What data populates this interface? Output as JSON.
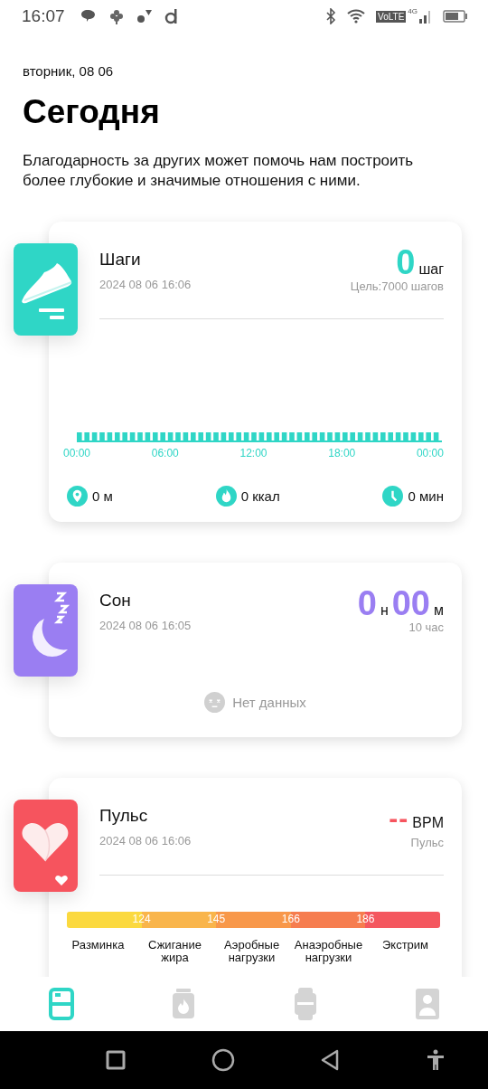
{
  "status_bar": {
    "time": "16:07",
    "network_type": "VoLTE",
    "network_generation": "4G"
  },
  "date": "вторник, 08 06",
  "title": "Сегодня",
  "quote": "Благодарность за других может помочь нам построить более глубокие и значимые отношения с ними.",
  "steps_card": {
    "title": "Шаги",
    "timestamp": "2024 08 06 16:06",
    "value": "0",
    "unit": "шаг",
    "goal": "Цель:7000 шагов",
    "axis_labels": [
      "00:00",
      "06:00",
      "12:00",
      "18:00",
      "00:00"
    ],
    "stats": [
      {
        "kind": "distance",
        "text": "0 м"
      },
      {
        "kind": "calories",
        "text": "0 ккал"
      },
      {
        "kind": "duration",
        "text": "0 мин"
      }
    ]
  },
  "sleep_card": {
    "title": "Сон",
    "timestamp": "2024 08 06 16:05",
    "hours": "0",
    "hours_unit": "н",
    "minutes": "00",
    "minutes_unit": "м",
    "goal": "10 час",
    "empty_message": "Нет данных"
  },
  "pulse_card": {
    "title": "Пульс",
    "timestamp": "2024 08 06 16:06",
    "value": "--",
    "unit": "BPM",
    "subtitle": "Пульс",
    "thresholds": [
      "124",
      "145",
      "166",
      "186"
    ],
    "zones": [
      {
        "label": "Разминка",
        "color": "#fbd93f"
      },
      {
        "label": "Сжигание жира",
        "color": "#f9b54b"
      },
      {
        "label": "Аэробные нагрузки",
        "color": "#f8984a"
      },
      {
        "label": "Анаэробные нагрузки",
        "color": "#f67d4f"
      },
      {
        "label": "Экстрим",
        "color": "#f4575f"
      }
    ]
  },
  "tabs": [
    {
      "selected": true
    },
    {
      "selected": false
    },
    {
      "selected": false
    },
    {
      "selected": false
    }
  ]
}
